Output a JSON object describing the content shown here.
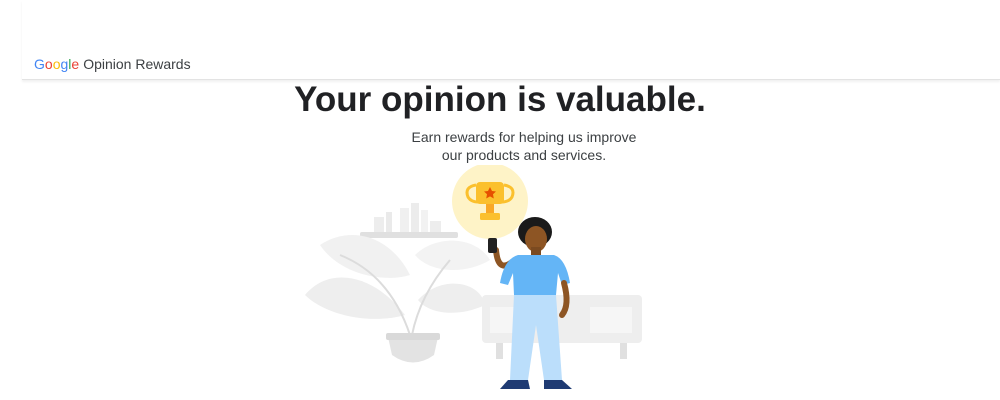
{
  "header": {
    "brand_letters": [
      "G",
      "o",
      "o",
      "g",
      "l",
      "e"
    ],
    "product": "Opinion Rewards",
    "brand_colors": [
      "#4285F4",
      "#EA4335",
      "#FBBC05",
      "#4285F4",
      "#34A853",
      "#EA4335"
    ]
  },
  "hero": {
    "title": "Your opinion is valuable.",
    "subtitle_line1": "Earn rewards for helping us improve",
    "subtitle_line2": "our products and services."
  },
  "illustration": {
    "icons": [
      "trophy-icon",
      "plant-icon",
      "bench-icon",
      "shelf-icon",
      "person-with-phone"
    ],
    "accent_yellow": "#FBC02D",
    "bubble_color": "#FEF3C7",
    "shirt_color": "#64B5F6",
    "pants_color": "#BBDEFB"
  }
}
